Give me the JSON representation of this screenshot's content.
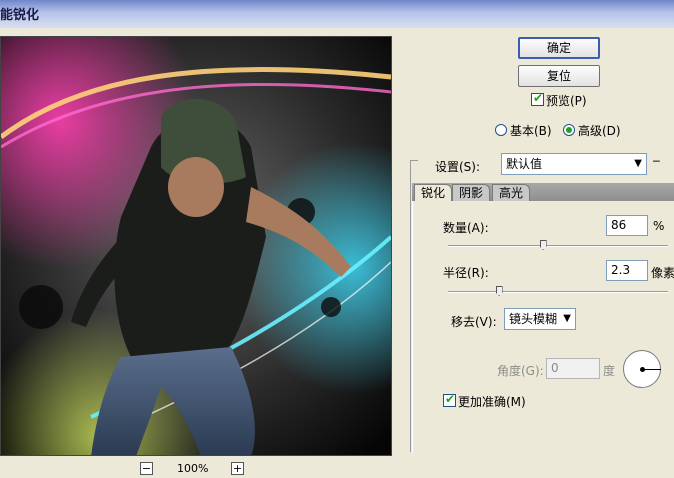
{
  "window": {
    "title": "能锐化"
  },
  "zoom": {
    "minus": "−",
    "plus": "+",
    "value": "100%"
  },
  "buttons": {
    "ok": "确定",
    "reset": "复位"
  },
  "preview": {
    "label": "预览(P)",
    "checked": true
  },
  "mode": {
    "basic": "基本(B)",
    "advanced": "高级(D)",
    "selected": "advanced"
  },
  "settings": {
    "label": "设置(S):",
    "value": "默认值"
  },
  "tabs": [
    {
      "label": "锐化",
      "active": true
    },
    {
      "label": "阴影",
      "active": false
    },
    {
      "label": "高光",
      "active": false
    }
  ],
  "amount": {
    "label": "数量(A):",
    "value": "86",
    "unit": "%",
    "slider_fraction": 0.43
  },
  "radius": {
    "label": "半径(R):",
    "value": "2.3",
    "unit": "像素",
    "slider_fraction": 0.23
  },
  "remove": {
    "label": "移去(V):",
    "value": "镜头模糊"
  },
  "angle": {
    "label": "角度(G):",
    "value": "0",
    "unit": "度"
  },
  "more_accurate": {
    "label": "更加准确(M)",
    "checked": true
  },
  "colors": {
    "accent": "#3b5cb0",
    "check": "#21a121",
    "dialog_bg": "#ece9d8"
  }
}
